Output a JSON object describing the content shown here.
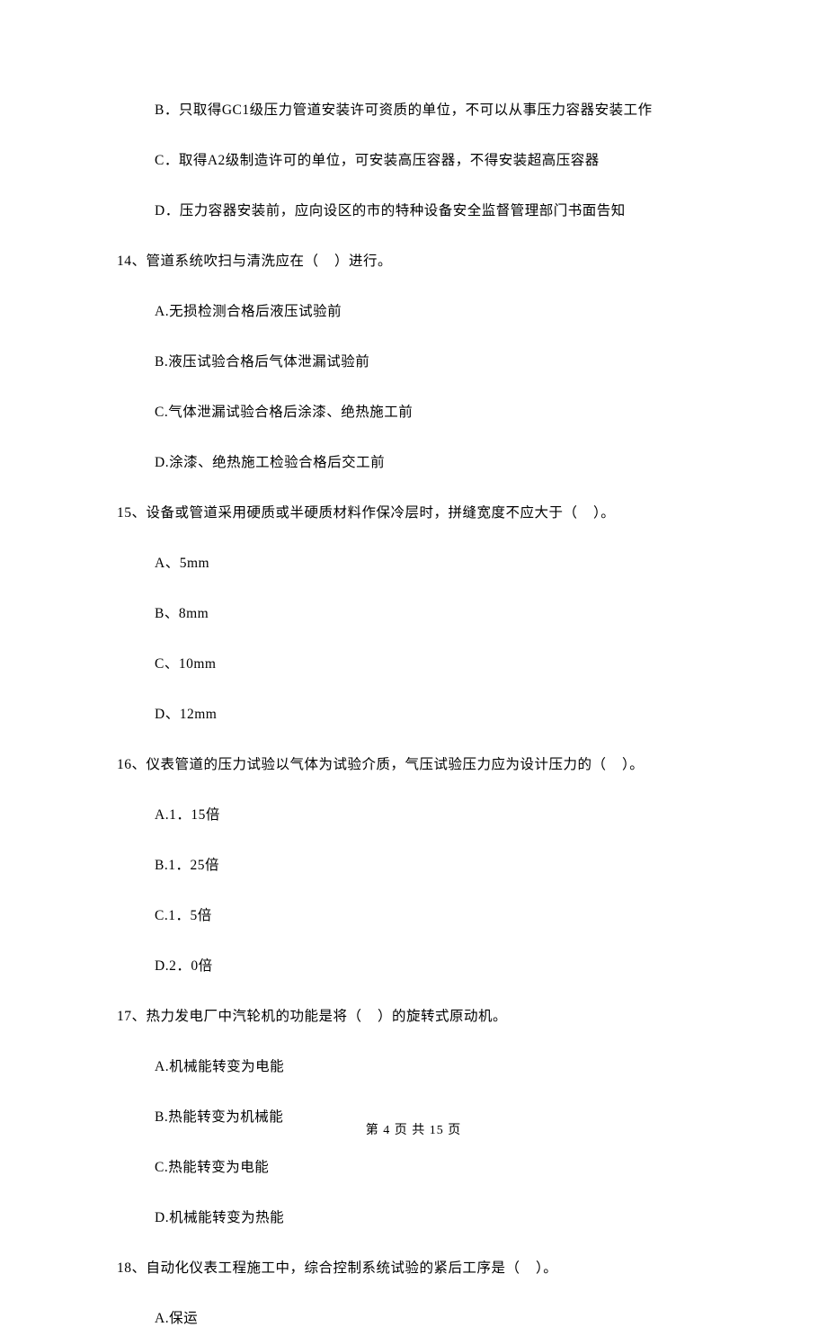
{
  "prev_question_trailing_options": [
    "B．只取得GC1级压力管道安装许可资质的单位，不可以从事压力容器安装工作",
    "C．取得A2级制造许可的单位，可安装高压容器，不得安装超高压容器",
    "D．压力容器安装前，应向设区的市的特种设备安全监督管理部门书面告知"
  ],
  "questions": [
    {
      "stem": "14、管道系统吹扫与清洗应在（    ）进行。",
      "options": [
        "A.无损检测合格后液压试验前",
        "B.液压试验合格后气体泄漏试验前",
        "C.气体泄漏试验合格后涂漆、绝热施工前",
        "D.涂漆、绝热施工检验合格后交工前"
      ]
    },
    {
      "stem": "15、设备或管道采用硬质或半硬质材料作保冷层时，拼缝宽度不应大于（    ）。",
      "options": [
        "A、5mm",
        "B、8mm",
        "C、10mm",
        "D、12mm"
      ]
    },
    {
      "stem": "16、仪表管道的压力试验以气体为试验介质，气压试验压力应为设计压力的（    ）。",
      "options": [
        "A.1．15倍",
        "B.1．25倍",
        "C.1．5倍",
        "D.2．0倍"
      ]
    },
    {
      "stem": "17、热力发电厂中汽轮机的功能是将（    ）的旋转式原动机。",
      "options": [
        "A.机械能转变为电能",
        "B.热能转变为机械能",
        "C.热能转变为电能",
        "D.机械能转变为热能"
      ]
    },
    {
      "stem": "18、自动化仪表工程施工中，综合控制系统试验的紧后工序是（    ）。",
      "options": [
        "A.保运"
      ]
    }
  ],
  "footer": "第 4 页 共 15 页"
}
